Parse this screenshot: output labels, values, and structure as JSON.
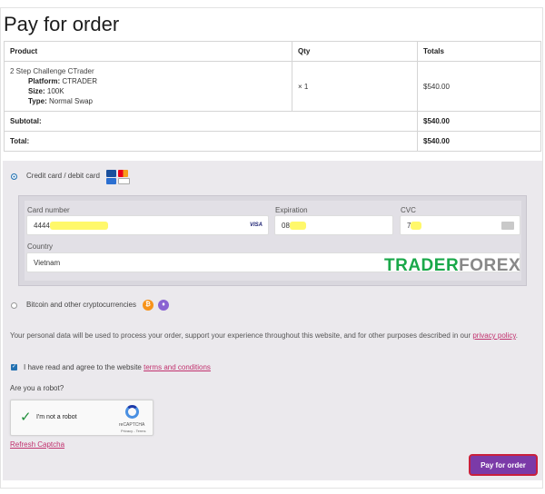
{
  "page_title": "Pay for order",
  "table": {
    "headers": {
      "product": "Product",
      "qty": "Qty",
      "totals": "Totals"
    },
    "item": {
      "name": "2 Step Challenge CTrader",
      "platform_label": "Platform:",
      "platform_value": "CTRADER",
      "size_label": "Size:",
      "size_value": "100K",
      "type_label": "Type:",
      "type_value": "Normal Swap",
      "qty": "× 1",
      "total": "$540.00"
    },
    "subtotal_label": "Subtotal:",
    "subtotal_value": "$540.00",
    "total_label": "Total:",
    "total_value": "$540.00"
  },
  "payment": {
    "card_option_label": "Credit card / debit card",
    "card_number_label": "Card number",
    "card_number_value": "4444",
    "card_brand": "VISA",
    "expiration_label": "Expiration",
    "expiration_value": "08",
    "cvc_label": "CVC",
    "cvc_value": "7",
    "country_label": "Country",
    "country_value": "Vietnam",
    "crypto_option_label": "Bitcoin and other cryptocurrencies",
    "bitcoin_glyph": "₿",
    "eth_glyph": "♦"
  },
  "watermark": {
    "part1": "TRADER",
    "part2": "FOREX"
  },
  "privacy": {
    "text": "Your personal data will be used to process your order, support your experience throughout this website, and for other purposes described in our ",
    "link": "privacy policy",
    "end": "."
  },
  "terms": {
    "text": "I have read and agree to the website ",
    "link": "terms and conditions"
  },
  "robot_question": "Are you a robot?",
  "captcha": {
    "label": "I'm not a robot",
    "brand": "reCAPTCHA",
    "links": "Privacy - Terms"
  },
  "refresh_captcha": "Refresh Captcha",
  "pay_button": "Pay for order",
  "colors": {
    "accent": "#7b3aa8",
    "link": "#c1306d",
    "watermark": "#1aa84a"
  }
}
